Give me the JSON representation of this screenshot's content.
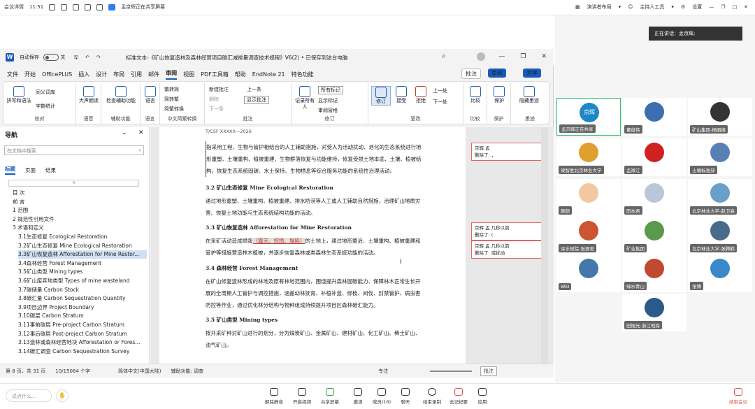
{
  "meeting": {
    "topbar": {
      "left_label": "会议详情",
      "time": "11:51",
      "sharing_text": "孟京辉正在共享屏幕",
      "presenter_layout": "演讲者布局",
      "host_tools": "主持人工具",
      "settings": "设置"
    },
    "speaker": "正在讲话：孟京辉;",
    "participants": [
      {
        "name": "孟京辉正在共享",
        "avatar_text": "京辉",
        "color": "#1e88c7",
        "active": true
      },
      {
        "name": "董俊伟",
        "color": "#3b6fb0"
      },
      {
        "name": "矿山集团-杨丽婧",
        "color": "#333"
      },
      {
        "name": "梁智胜北京林业大学",
        "color": "#e0a030"
      },
      {
        "name": "孟祥江",
        "color": "#d02020"
      },
      {
        "name": "土壤标准部",
        "color": "#5a7fb5"
      },
      {
        "name": "颜颜",
        "color": "#f2c8a0"
      },
      {
        "name": "田本君",
        "color": "#b9c7d8"
      },
      {
        "name": "北京林业大学-赵卫高",
        "color": "#6aa0c8"
      },
      {
        "name": "深水规院-张源君",
        "color": "#cc5533"
      },
      {
        "name": "矿业集团",
        "color": "#5a9a4a"
      },
      {
        "name": "北京林业大学-张腾鹤",
        "color": "#4a6a8a"
      },
      {
        "name": "WEI",
        "color": "#4477aa"
      },
      {
        "name": "绿水青山",
        "color": "#c04a30"
      },
      {
        "name": "张博",
        "color": "#3a88c8"
      },
      {
        "name": "田旭光-浙江地探",
        "color": "#2a5a8a"
      }
    ],
    "bottom": {
      "chat_placeholder": "说点什么...",
      "buttons": [
        "解除静音",
        "开启视频",
        "共享屏幕",
        "邀请",
        "成员(16)",
        "聊天",
        "结束录制",
        "云记纪要",
        "应用"
      ],
      "leave": "结束会议"
    }
  },
  "word": {
    "autosave": "自动保存",
    "autosave_state": "关",
    "title": "标准文本-《矿山恢复造林及森林经营项目碳汇减排量调查技术规程》V6(2) • 已保存到这台电脑",
    "menus": [
      "文件",
      "开始",
      "OfficePLUS",
      "插入",
      "设计",
      "布局",
      "引用",
      "邮件",
      "审阅",
      "视图",
      "PDF工具箱",
      "帮助",
      "EndNote 21",
      "特色功能"
    ],
    "active_menu": "审阅",
    "comment_btn": "批注",
    "review_btn": "审阅",
    "share_btn": "共享",
    "ribbon": {
      "proof": {
        "label": "校对",
        "spell": "拼写和语法",
        "thesaurus": "同义词库",
        "wordcount": "字数统计"
      },
      "speech": {
        "label": "语音",
        "read": "大声朗读"
      },
      "access": {
        "label": "辅助功能",
        "check": "检查辅助功能"
      },
      "lang": {
        "label": "语言",
        "lang": "语言"
      },
      "chinese": {
        "label": "中文简繁转换",
        "t2s": "繁转简",
        "s2t": "简转繁",
        "conv": "简繁转换"
      },
      "comment": {
        "label": "批注",
        "new": "新建批注",
        "delete": "删除",
        "prev": "上一条",
        "next": "下一条",
        "show": "显示批注"
      },
      "track": {
        "label": "修订",
        "mark_all": "所有标记",
        "show_markup": "显示标记",
        "review_pane": "审阅窗格",
        "track": "修订",
        "record_all": "记录所有人"
      },
      "changes": {
        "label": "更改",
        "accept": "接受",
        "reject": "拒绝",
        "prev": "上一处",
        "next": "下一处"
      },
      "compare": {
        "label": "比较",
        "btn": "比较"
      },
      "protect": {
        "label": "保护",
        "btn": "保护"
      },
      "ink": {
        "label": "墨迹",
        "btn": "隐藏墨迹"
      }
    },
    "nav": {
      "title": "导航",
      "search": "在文档中搜索",
      "tabs": [
        "标题",
        "页面",
        "结果"
      ],
      "items": [
        {
          "t": "目 次",
          "l": 0
        },
        {
          "t": "前 言",
          "l": 0
        },
        {
          "t": "1 范围",
          "l": 0
        },
        {
          "t": "2 规范性引用文件",
          "l": 0
        },
        {
          "t": "3 术语和定义",
          "l": 0
        },
        {
          "t": "3.1生态修复 Ecological Restoration",
          "l": 1
        },
        {
          "t": "3.2矿山生态修复 Mine Ecological Restoration",
          "l": 1
        },
        {
          "t": "3.3矿山恢复造林 Afforestation for Mine Restor...",
          "l": 1,
          "sel": true
        },
        {
          "t": "3.4森林经营 Forest Management",
          "l": 1
        },
        {
          "t": "3.5矿山类型 Mining types",
          "l": 1
        },
        {
          "t": "3.6矿山废弃地类型 Types of mine wasteland",
          "l": 1
        },
        {
          "t": "3.7碳储量 Carbon Stock",
          "l": 1
        },
        {
          "t": "3.8碳汇量 Carbon Sequestration Quantity",
          "l": 1
        },
        {
          "t": "3.9项目边界 Project Boundary",
          "l": 1
        },
        {
          "t": "3.10碳层 Carbon Stratum",
          "l": 1
        },
        {
          "t": "3.11事前碳层 Pre-project Carbon Stratum",
          "l": 1
        },
        {
          "t": "3.12事后碳层 Post-project Carbon Stratum",
          "l": 1
        },
        {
          "t": "3.13造林或森林经营地块 Afforestation or Fores...",
          "l": 1
        },
        {
          "t": "3.14碳汇调查 Carbon Sequestration Survey",
          "l": 1
        }
      ]
    },
    "doc": {
      "header": "T/CSF XXXXX—2026",
      "p1": "指采用工程、生物与管护相结合的人工辅助措施，对受人为活动扰动、退化的生态系统进行地形重塑、土壤重构、植被重建、生物群落恢复与功能维持，修复受损土地本底、土壤、植被结构，恢复生态系统固碳、水土保持、生物栖息等综合服务功能的系统性治理活动。",
      "h32": "3.2 矿山生态修复 Mine Ecological Restoration",
      "p2": "通过地形重塑、土壤重构、植被重建、排水防涝等人工或人工辅助自然措施，治理矿山地质灾害、恢复土地功能与生态系统结构功能的活动。",
      "h33": "3.3 矿山恢复造林 Afforestation for Mine Restoration",
      "p3a": "在采矿活动造成损毁",
      "p3b": "（露天、挖损、塌陷）",
      "p3c": "的土地上，通过地形整治、土壤重构、植被重建和管护等措施营造林木植被，并逐步恢复森林或类森林生态系统功能的活动。",
      "h34": "3.4 森林经营 Forest Management",
      "p4": "在矿山修复造林形成的林地及原有林地范围内，围绕提升森林固碳能力、保障林木正常生长开展的全周期人工管护与调控措施，涵盖幼林抚育、补植补造、修枝、间伐、封禁管护、病虫害防控等作业，通过优化林分结构与物种组成持续提升项目区森林碳汇能力。",
      "h35": "3.5 矿山类型 Mining types",
      "p5": "按开采矿种对矿山进行的划分，分为煤炭矿山、金属矿山、建材矿山、化工矿山、稀土矿山、油气矿山。"
    },
    "comments": [
      {
        "author": "京辉 孟",
        "time": "",
        "text": "删除了: ，"
      },
      {
        "author": "京辉 孟",
        "time": "几秒以前",
        "text": "删除了: ("
      },
      {
        "author": "京辉 孟",
        "time": "几秒以前",
        "text": "删除了: 或扰动"
      }
    ],
    "status": {
      "page": "第 8 页，共 31 页",
      "words": "10/15064 个字",
      "lang": "简体中文(中国大陆)",
      "access": "辅助功能: 调查",
      "focus": "专注",
      "comment": "批注"
    }
  }
}
